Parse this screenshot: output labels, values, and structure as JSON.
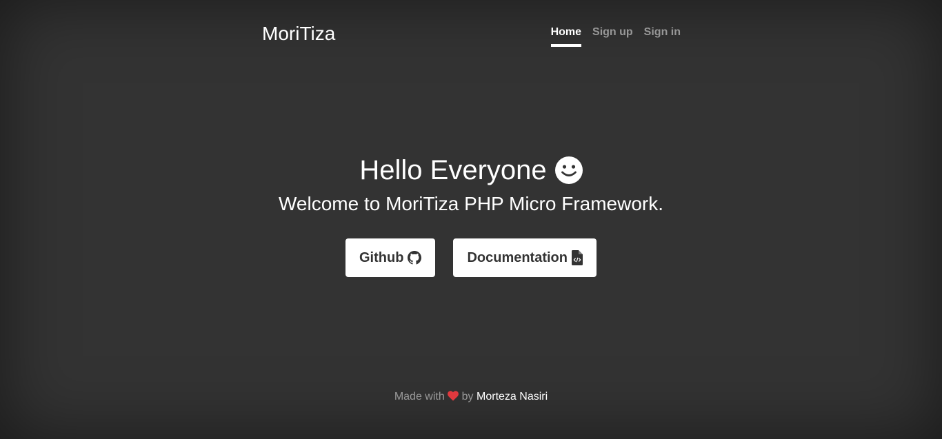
{
  "brand": "MoriTiza",
  "nav": {
    "items": [
      {
        "label": "Home",
        "active": true
      },
      {
        "label": "Sign up",
        "active": false
      },
      {
        "label": "Sign in",
        "active": false
      }
    ]
  },
  "hero": {
    "heading": "Hello Everyone",
    "heading_icon": "smile-icon",
    "subheading": "Welcome to MoriTiza PHP Micro Framework."
  },
  "buttons": {
    "github_label": "Github",
    "github_icon": "github-icon",
    "docs_label": "Documentation",
    "docs_icon": "file-code-icon"
  },
  "footer": {
    "prefix": "Made with",
    "heart_icon": "heart-icon",
    "heart_color": "#e0393e",
    "by": "by",
    "author": "Morteza Nasiri"
  }
}
